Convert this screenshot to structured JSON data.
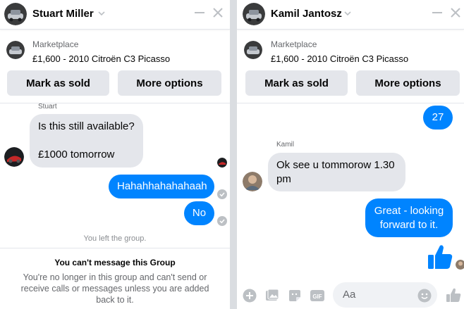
{
  "left_chat": {
    "contact_name": "Stuart Miller",
    "marketplace": {
      "label": "Marketplace",
      "listing": "£1,600 - 2010 Citroën C3 Picasso",
      "mark_sold": "Mark as sold",
      "more_options": "More options"
    },
    "messages": {
      "sender_name": "Stuart",
      "incoming_lines": [
        "Is this still available?",
        "£1000 tomorrow"
      ],
      "outgoing": [
        "Hahahhahahahaah",
        "No"
      ]
    },
    "system_message": "You left the group.",
    "notice": {
      "title": "You can't message this Group",
      "body": "You're no longer in this group and can't send or receive calls or messages unless you are added back to it."
    }
  },
  "right_chat": {
    "contact_name": "Kamil Jantosz",
    "marketplace": {
      "label": "Marketplace",
      "listing": "£1,600 - 2010 Citroën C3 Picasso",
      "mark_sold": "Mark as sold",
      "more_options": "More options"
    },
    "messages": {
      "outgoing_top": "27",
      "sender_name": "Kamil",
      "incoming": "Ok see u tommorow 1.30 pm",
      "outgoing": "Great  - looking forward to it."
    },
    "composer": {
      "placeholder": "Aa",
      "icons": [
        "plus-icon",
        "photo-icon",
        "sticker-icon",
        "gif-icon",
        "emoji-icon",
        "like-icon"
      ]
    }
  },
  "colors": {
    "accent": "#0084ff",
    "bubble_in": "#e4e6eb",
    "button_bg": "#e4e6eb",
    "muted_text": "#65676b"
  }
}
